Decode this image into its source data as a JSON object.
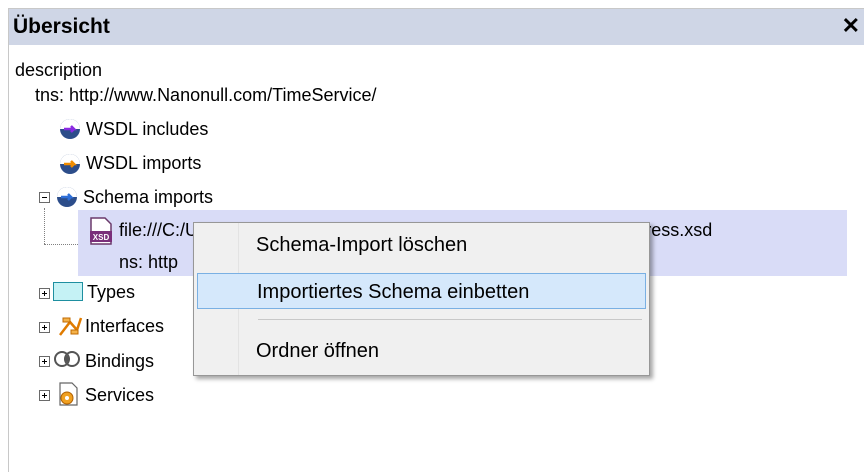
{
  "panel": {
    "title": "Übersicht",
    "close_glyph": "✕"
  },
  "tree": {
    "root": "description",
    "tns_label": "tns:",
    "tns_value": "http://www.Nanonull.com/TimeService/",
    "wsdl_includes": "WSDL includes",
    "wsdl_imports": "WSDL imports",
    "schema_imports": "Schema imports",
    "file_path": "file:///C:/Users/pnf/Documents/Altova/XMLSpy2013/Examples/address.xsd",
    "ns_partial": "ns: http",
    "types": "Types",
    "interfaces": "Interfaces",
    "bindings": "Bindings",
    "services": "Services",
    "xsd_icon_text": "XSD"
  },
  "context_menu": {
    "items": [
      "Schema-Import löschen",
      "Importiertes Schema einbetten",
      "Ordner öffnen"
    ]
  },
  "colors": {
    "titlebar": "#cfd6e6",
    "selection": "#d9dcf7",
    "menu_highlight": "#d5e8fb"
  }
}
